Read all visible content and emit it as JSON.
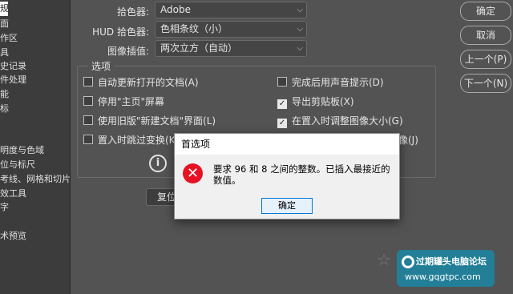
{
  "sidebar": {
    "items": [
      {
        "label": "规"
      },
      {
        "label": "面"
      },
      {
        "label": "作区"
      },
      {
        "label": "具"
      },
      {
        "label": "史记录"
      },
      {
        "label": "件处理"
      },
      {
        "label": "能"
      },
      {
        "label": "标"
      },
      {
        "label": "明度与色域"
      },
      {
        "label": "位与标尺"
      },
      {
        "label": "考线、网格和切片"
      },
      {
        "label": "效工具"
      },
      {
        "label": "字"
      },
      {
        "label": "术预览"
      }
    ]
  },
  "form": {
    "color_picker_label": "拾色器:",
    "color_picker_value": "Adobe",
    "hud_picker_label": "HUD 拾色器:",
    "hud_picker_value": "色相条纹（小）",
    "interp_label": "图像插值:",
    "interp_value": "两次立方（自动）"
  },
  "options": {
    "legend": "选项",
    "items": [
      {
        "label": "自动更新打开的文档(A)",
        "checked": false
      },
      {
        "label": "完成后用声音提示(D)",
        "checked": false
      },
      {
        "label": "停用\"主页\"屏幕",
        "checked": false
      },
      {
        "label": "导出剪贴板(X)",
        "checked": true
      },
      {
        "label": "使用旧版\"新建文档\"界面(L)",
        "checked": false
      },
      {
        "label": "在置入时调整图像大小(G)",
        "checked": true
      },
      {
        "label": "置入时跳过变换(K)",
        "checked": false
      },
      {
        "label": "像(J)",
        "checked": false
      }
    ],
    "check_glyph": "✓"
  },
  "reset_label": "复位",
  "side_buttons": {
    "ok": "确定",
    "cancel": "取消",
    "prev": "上一个(P)",
    "next": "下一个(N)"
  },
  "dialog": {
    "title": "首选项",
    "message": "要求 96 和 8 之间的整数。已插入最接近的数值。",
    "ok_label": "确定",
    "error_glyph": "✕"
  },
  "info_glyph": "i",
  "watermark": {
    "title": "过期罐头电脑论坛",
    "url": "www.gqgtpc.com"
  },
  "colors": {
    "panel_bg": "#535353",
    "error_red": "#e81123",
    "focus_blue": "#0078d7"
  }
}
